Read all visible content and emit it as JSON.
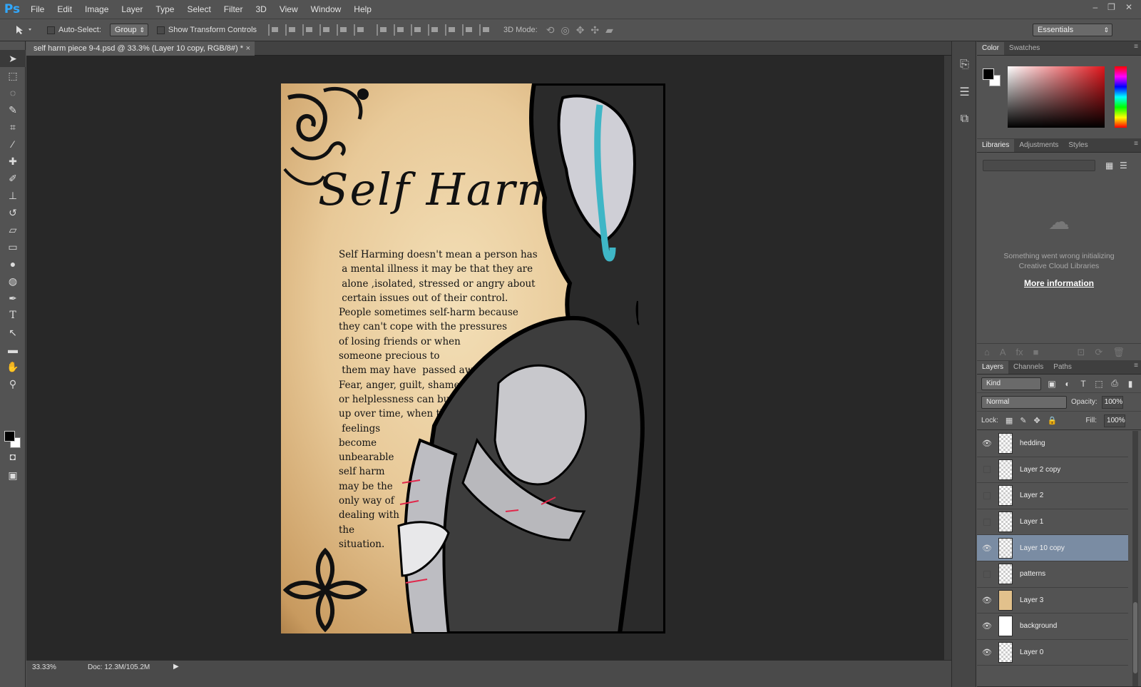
{
  "app": {
    "logo": "Ps"
  },
  "menu": [
    "File",
    "Edit",
    "Image",
    "Layer",
    "Type",
    "Select",
    "Filter",
    "3D",
    "View",
    "Window",
    "Help"
  ],
  "window_controls": [
    "–",
    "❐",
    "✕"
  ],
  "options": {
    "auto_select_label": "Auto-Select:",
    "auto_select_value": "Group",
    "transform_label": "Show Transform Controls",
    "mode3d_label": "3D Mode:",
    "workspace": "Essentials"
  },
  "document": {
    "tab_title": "self harm piece 9-4.psd @ 33.3% (Layer 10 copy, RGB/8#) *",
    "close": "×",
    "zoom": "33.33%",
    "doc_size": "Doc: 12.3M/105.2M",
    "status_arrow": "▶"
  },
  "artwork": {
    "title": "Self Harm",
    "text": "Self Harming doesn't mean a person has\n a mental illness it may be that they are\n alone ,isolated, stressed or angry about\n certain issues out of their control.\nPeople sometimes self-harm because\nthey can't cope with the pressures\nof losing friends or when\nsomeone precious to\n them may have  passed away\nFear, anger, guilt, shame\nor helplessness can build\nup over time, when these\n feelings\nbecome\nunbearable\nself harm\nmay be the\nonly way of\ndealing with\nthe\nsituation."
  },
  "color_panel": {
    "tabs": [
      "Color",
      "Swatches"
    ],
    "fg": "#000000",
    "bg": "#ffffff"
  },
  "libraries_panel": {
    "tabs": [
      "Libraries",
      "Adjustments",
      "Styles"
    ],
    "error": "Something went wrong initializing Creative Cloud Libraries",
    "more_info": "More information"
  },
  "layers_panel": {
    "tabs": [
      "Layers",
      "Channels",
      "Paths"
    ],
    "kind": "Kind",
    "blend_mode": "Normal",
    "opacity_label": "Opacity:",
    "opacity": "100%",
    "lock_label": "Lock:",
    "fill_label": "Fill:",
    "fill": "100%",
    "layers": [
      {
        "name": "hedding",
        "visible": true,
        "thumb": "transparent"
      },
      {
        "name": "Layer 2 copy",
        "visible": false,
        "thumb": "transparent"
      },
      {
        "name": "Layer 2",
        "visible": false,
        "thumb": "transparent"
      },
      {
        "name": "Layer 1",
        "visible": false,
        "thumb": "transparent"
      },
      {
        "name": "Layer 10 copy",
        "visible": true,
        "thumb": "transparent",
        "selected": true
      },
      {
        "name": "patterns",
        "visible": false,
        "thumb": "transparent"
      },
      {
        "name": "Layer 3",
        "visible": true,
        "thumb": "paper"
      },
      {
        "name": "background",
        "visible": true,
        "thumb": "white"
      },
      {
        "name": "Layer 0",
        "visible": true,
        "thumb": "transparent"
      }
    ]
  },
  "colors": {
    "accent_selected": "#7a8ca3",
    "ps_blue": "#31a8ff"
  }
}
